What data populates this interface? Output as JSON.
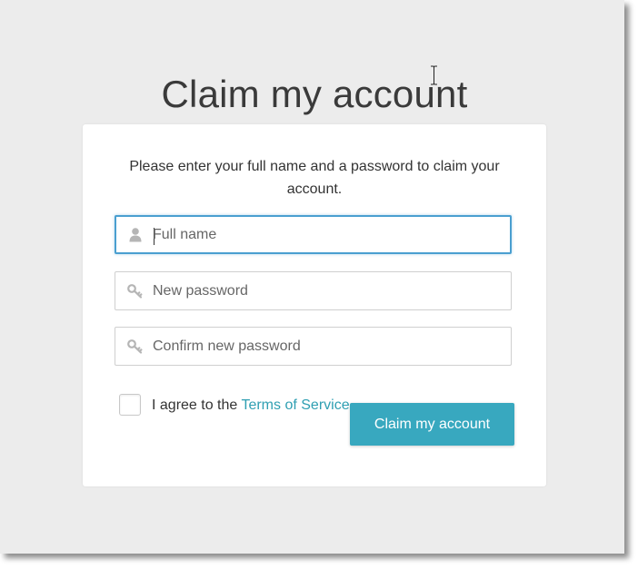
{
  "page": {
    "title": "Claim my account"
  },
  "form": {
    "intro_text": "Please enter your full name and a password to claim your account.",
    "full_name": {
      "placeholder": "Full name",
      "value": "",
      "icon": "user-icon",
      "focused": true
    },
    "new_password": {
      "placeholder": "New password",
      "value": "",
      "icon": "key-icon"
    },
    "confirm_password": {
      "placeholder": "Confirm new password",
      "value": "",
      "icon": "key-icon"
    },
    "agree": {
      "prefix": "I agree to the ",
      "link_text": "Terms of Service",
      "checked": false
    },
    "submit_label": "Claim my account"
  },
  "colors": {
    "background": "#ececec",
    "card": "#ffffff",
    "accent": "#38a8bf",
    "link": "#2f9fb2",
    "focus_border": "#4a9fd0"
  }
}
